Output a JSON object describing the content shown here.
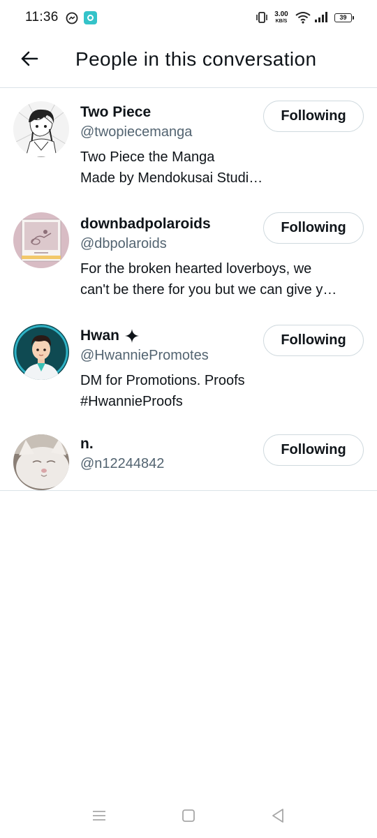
{
  "status_bar": {
    "time": "11:36",
    "net_speed_value": "3.00",
    "net_speed_unit": "KB/S",
    "battery": "39"
  },
  "header": {
    "title": "People in this conversation"
  },
  "people": [
    {
      "name": "Two Piece",
      "handle": "@twopiecemanga",
      "bio_lines": [
        "Two Piece the Manga",
        "Made by Mendokusai Studi…"
      ],
      "button": "Following",
      "verified": false
    },
    {
      "name": "downbadpolaroids",
      "handle": "@dbpolaroids",
      "bio_lines": [
        "For the broken hearted loverboys, we",
        "can't be there for you but we can give y…"
      ],
      "button": "Following",
      "verified": false
    },
    {
      "name": "Hwan",
      "handle": "@HwanniePromotes",
      "bio_lines": [
        "DM for Promotions. Proofs",
        "#HwannieProofs"
      ],
      "button": "Following",
      "verified": true
    },
    {
      "name": "n.",
      "handle": "@n12244842",
      "bio_lines": [],
      "button": "Following",
      "verified": false
    }
  ],
  "icons": {
    "back": "arrow-left-icon",
    "name_badge": "sparkle-icon",
    "nav": [
      "menu-icon",
      "home-square-icon",
      "back-triangle-icon"
    ]
  },
  "colors": {
    "text_primary": "#0f1419",
    "text_secondary": "#536471",
    "divider": "#dbe3e8",
    "button_border": "#cfd9de"
  }
}
